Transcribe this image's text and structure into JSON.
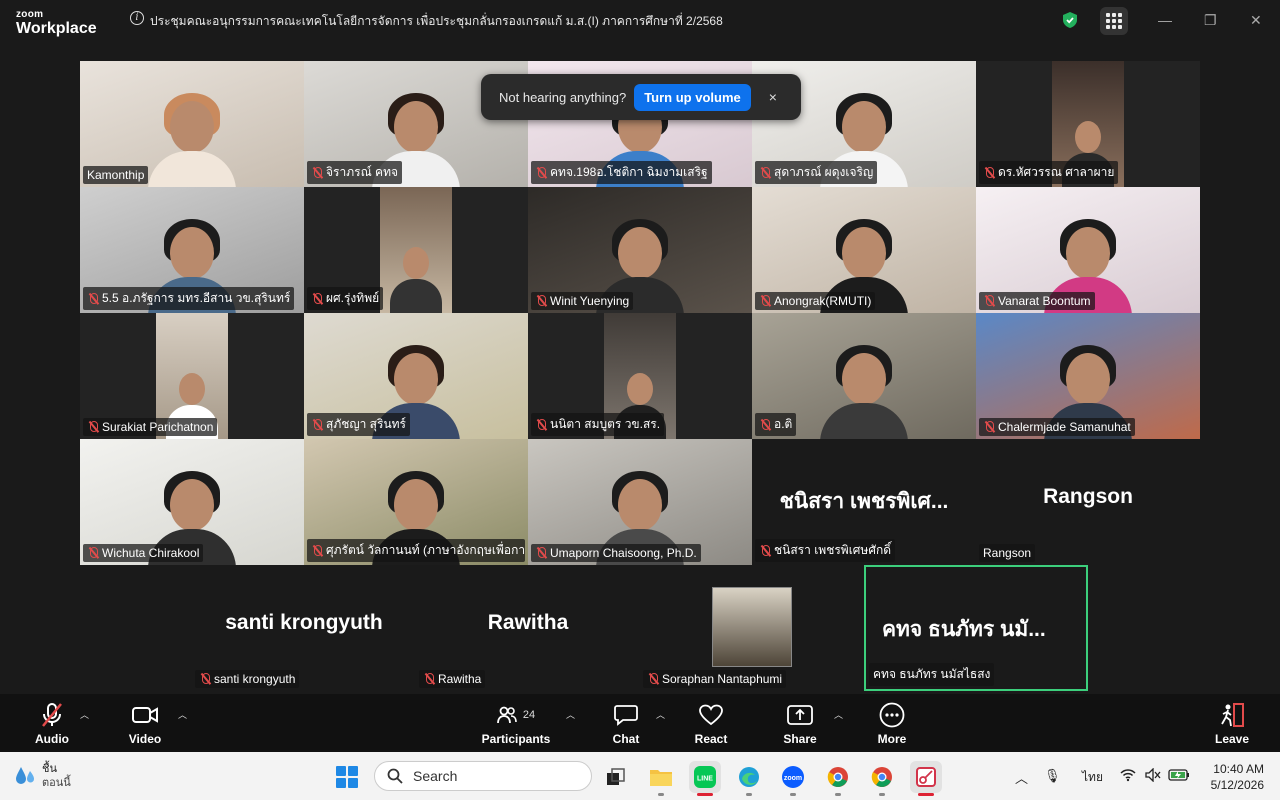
{
  "titlebar": {
    "logo_top": "zoom",
    "logo_bottom": "Workplace",
    "meeting_title": "ประชุมคณะอนุกรรมการคณะเทคโนโลยีการจัดการ เพื่อประชุมกลั่นกรองเกรดแก้ ม.ส.(I) ภาคการศึกษาที่ 2/2568"
  },
  "popup": {
    "message": "Not hearing anything?",
    "button": "Turn up volume",
    "close": "×"
  },
  "participants": [
    {
      "name": "Kamonthip",
      "muted": false
    },
    {
      "name": "จิราภรณ์ คทจ",
      "muted": true
    },
    {
      "name": "คทจ.198อ.โชติกา ฉิมงามเสริฐ",
      "muted": true
    },
    {
      "name": "สุดาภรณ์  ผดุงเจริญ",
      "muted": true
    },
    {
      "name": "ดร.หัศวรรณ ศาลาผาย",
      "muted": true
    },
    {
      "name": "5.5 อ.ภรัฐการ มทร.อีสาน วข.สุรินทร์",
      "muted": true
    },
    {
      "name": "ผศ.รุ่งทิพย์",
      "muted": true
    },
    {
      "name": "Winit Yuenying",
      "muted": true
    },
    {
      "name": "Anongrak(RMUTI)",
      "muted": true
    },
    {
      "name": "Vanarat Boontum",
      "muted": true
    },
    {
      "name": "Surakiat Parichatnon",
      "muted": true
    },
    {
      "name": "สุภัชญา สุรินทร์",
      "muted": true
    },
    {
      "name": "นนิตา สมบูตร วข.สร.",
      "muted": true
    },
    {
      "name": "อ.ติ",
      "muted": true
    },
    {
      "name": "Chalermjade Samanuhat",
      "muted": true
    },
    {
      "name": "Wichuta Chirakool",
      "muted": true
    },
    {
      "name": "ศุภรัตน์ วัลกานนท์ (ภาษาอังกฤษเพื่อการ...",
      "muted": true
    },
    {
      "name": "Umaporn Chaisoong, Ph.D.",
      "muted": true
    },
    {
      "name": "ชนิสรา เพชรพิเศษศักดิ์",
      "muted": true,
      "display": "ชนิสรา เพชรพิเศ..."
    },
    {
      "name": "Rangson",
      "muted": false,
      "display": "Rangson"
    },
    {
      "name": "santi krongyuth",
      "muted": true,
      "display": "santi krongyuth"
    },
    {
      "name": "Rawitha",
      "muted": true,
      "display": "Rawitha"
    },
    {
      "name": "Soraphan Nantaphumi",
      "muted": true
    },
    {
      "name": "คทจ  ธนภัทร นมัสไธสง",
      "muted": false,
      "display": "คทจ  ธนภัทร นมั..."
    }
  ],
  "toolbar": {
    "audio": "Audio",
    "video": "Video",
    "participants": "Participants",
    "participants_count": "24",
    "chat": "Chat",
    "react": "React",
    "share": "Share",
    "more": "More",
    "leave": "Leave"
  },
  "taskbar": {
    "weather_line1": "ชื้น",
    "weather_line2": "ตอนนี้",
    "search_placeholder": "Search",
    "language": "ไทย",
    "time": "10:40 AM",
    "date": "5/12/2026"
  },
  "colors": {
    "active_speaker": "#3ccf7c",
    "primary_button": "#0e72ed",
    "muted_icon": "#e24b4b"
  }
}
